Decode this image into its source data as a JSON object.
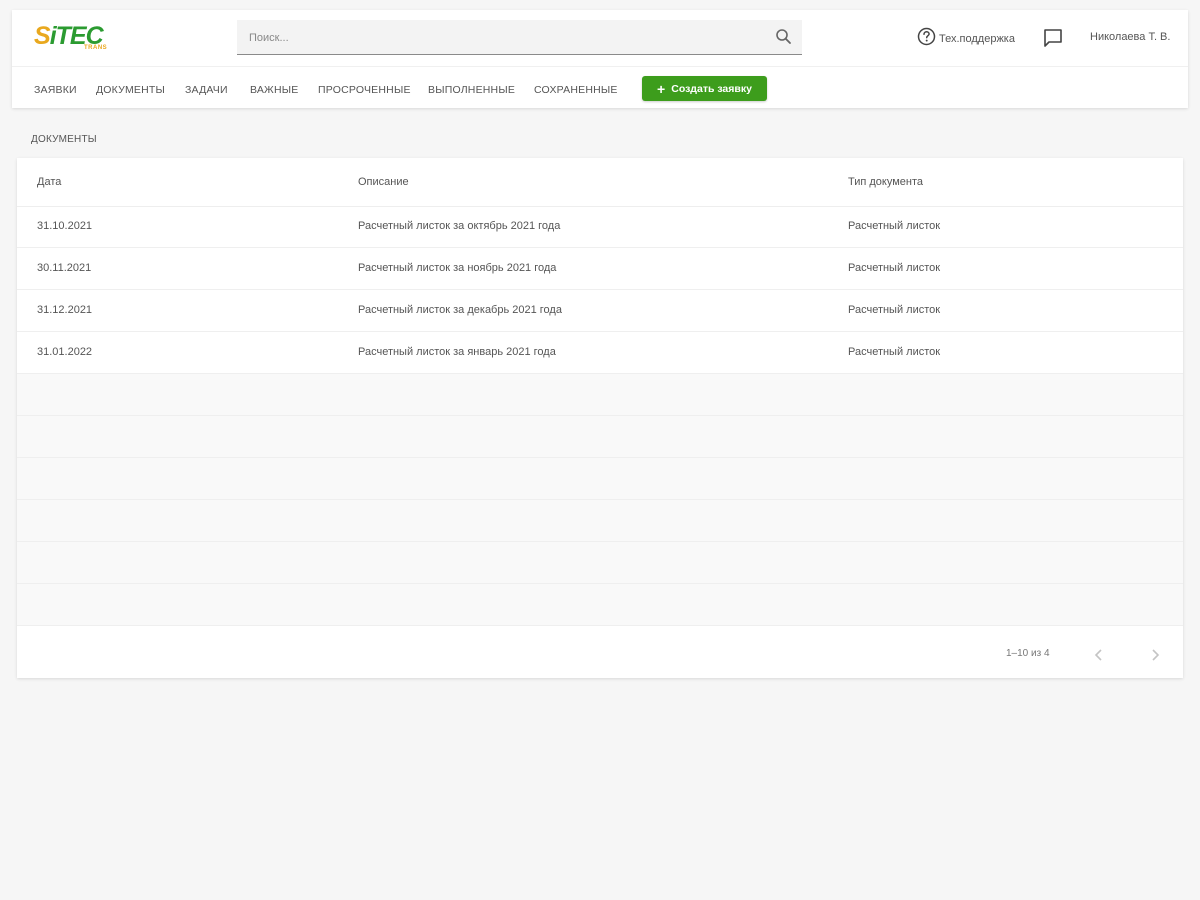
{
  "brand": {
    "logo_text_first": "S",
    "logo_text_rest": "iTEC",
    "logo_sub": "TRANS",
    "colors": {
      "yellow": "#e9a81e",
      "green": "#2b9b31",
      "button_green": "#3d9d1c"
    }
  },
  "header": {
    "search": {
      "placeholder": "Поиск...",
      "value": "",
      "icon": "search-icon"
    },
    "support_label": "Тех.поддержка",
    "support_icon": "help-circle-icon",
    "chat_icon": "chat-icon",
    "user_name": "Николаева Т. В."
  },
  "nav": {
    "items": [
      {
        "label": "ЗАЯВКИ"
      },
      {
        "label": "ДОКУМЕНТЫ"
      },
      {
        "label": "ЗАДАЧИ"
      },
      {
        "label": "ВАЖНЫЕ"
      },
      {
        "label": "ПРОСРОЧЕННЫЕ"
      },
      {
        "label": "ВЫПОЛНЕННЫЕ"
      },
      {
        "label": "СОХРАНЕННЫЕ"
      }
    ],
    "create_button": "Создать заявку"
  },
  "page": {
    "title": "ДОКУМЕНТЫ"
  },
  "table": {
    "columns": [
      "Дата",
      "Описание",
      "Тип документа"
    ],
    "rows": [
      [
        "31.10.2021",
        "Расчетный листок за октябрь 2021 года",
        "Расчетный листок"
      ],
      [
        "30.11.2021",
        "Расчетный листок за ноябрь 2021 года",
        "Расчетный листок"
      ],
      [
        "31.12.2021",
        "Расчетный листок за декабрь 2021 года",
        "Расчетный листок"
      ],
      [
        "31.01.2022",
        "Расчетный листок за январь 2021 года",
        "Расчетный листок"
      ]
    ],
    "pagination": {
      "info": "1–10 из 4",
      "prev_icon": "chevron-left-icon",
      "next_icon": "chevron-right-icon"
    }
  }
}
